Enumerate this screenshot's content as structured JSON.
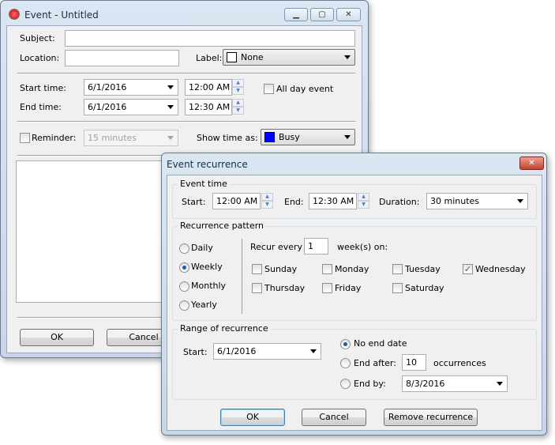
{
  "event_window": {
    "title": "Event - Untitled",
    "subject_label": "Subject:",
    "subject_value": "",
    "location_label": "Location:",
    "location_value": "",
    "label_label": "Label:",
    "label_value": "None",
    "label_color": "#ffffff",
    "start_label": "Start time:",
    "start_date": "6/1/2016",
    "start_time": "12:00 AM",
    "end_label": "End time:",
    "end_date": "6/1/2016",
    "end_time": "12:30 AM",
    "all_day_label": "All day event",
    "all_day_checked": false,
    "reminder_label": "Reminder:",
    "reminder_checked": false,
    "reminder_value": "15 minutes",
    "show_time_label": "Show time as:",
    "show_time_value": "Busy",
    "show_time_color": "#0000ff",
    "ok": "OK",
    "cancel": "Cancel"
  },
  "recurrence": {
    "title": "Event recurrence",
    "event_time_group": "Event time",
    "start_label": "Start:",
    "start_time": "12:00 AM",
    "end_label": "End:",
    "end_time": "12:30 AM",
    "duration_label": "Duration:",
    "duration_value": "30 minutes",
    "pattern_group": "Recurrence pattern",
    "patterns": [
      "Daily",
      "Weekly",
      "Monthly",
      "Yearly"
    ],
    "selected_pattern": "Weekly",
    "recur_every_label": "Recur every",
    "recur_every_value": "1",
    "weeks_on_label": "week(s) on:",
    "days": [
      {
        "label": "Sunday",
        "checked": false
      },
      {
        "label": "Monday",
        "checked": false
      },
      {
        "label": "Tuesday",
        "checked": false
      },
      {
        "label": "Wednesday",
        "checked": true
      },
      {
        "label": "Thursday",
        "checked": false
      },
      {
        "label": "Friday",
        "checked": false
      },
      {
        "label": "Saturday",
        "checked": false
      }
    ],
    "range_group": "Range of recurrence",
    "range_start_label": "Start:",
    "range_start_value": "6/1/2016",
    "no_end_label": "No end date",
    "end_after_label": "End after:",
    "end_after_value": "10",
    "occurrences_label": "occurrences",
    "end_by_label": "End by:",
    "end_by_value": "8/3/2016",
    "selected_range": "No end date",
    "ok": "OK",
    "cancel": "Cancel",
    "remove": "Remove recurrence"
  }
}
